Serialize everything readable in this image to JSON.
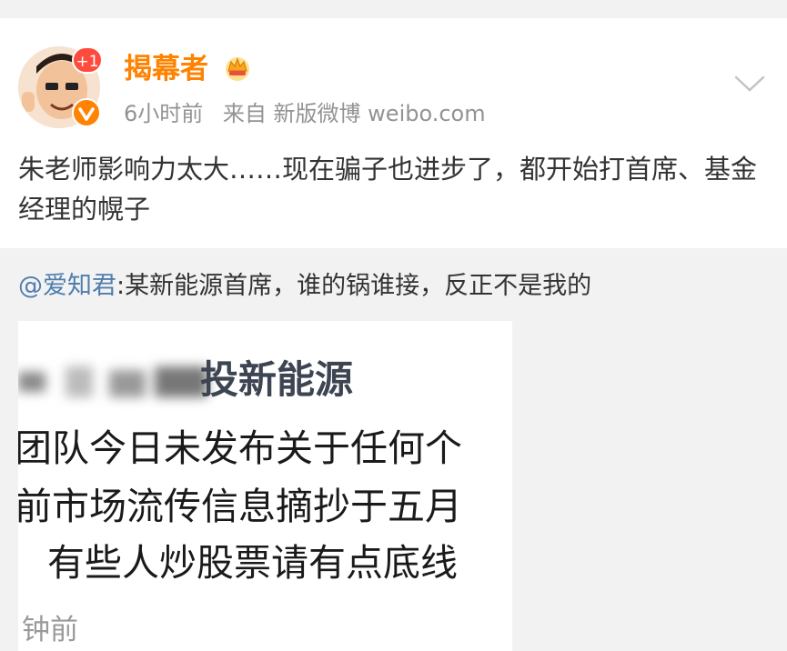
{
  "post": {
    "username": "揭幕者",
    "notification_count": "+1",
    "meta": {
      "time": "6小时前",
      "source": "来自 新版微博 weibo.com"
    },
    "text": "朱老师影响力太大……现在骗子也进步了，都开始打首席、基金经理的幌子"
  },
  "repost": {
    "mention": "@爱知君",
    "text": ":某新能源首席，谁的锅谁接，反正不是我的",
    "image": {
      "title": "投新能源",
      "lines": [
        "团队今日未发布关于任何个",
        "前市场流传信息摘抄于五月",
        "有些人炒股票请有点底线"
      ],
      "time": "钟前"
    }
  },
  "colors": {
    "username": "#ff8200",
    "mention": "#507daf",
    "badge": "#ff4b3e",
    "meta": "#939393"
  },
  "icons": [
    "avatar",
    "verified-icon",
    "crown-icon",
    "chevron-down-icon"
  ]
}
